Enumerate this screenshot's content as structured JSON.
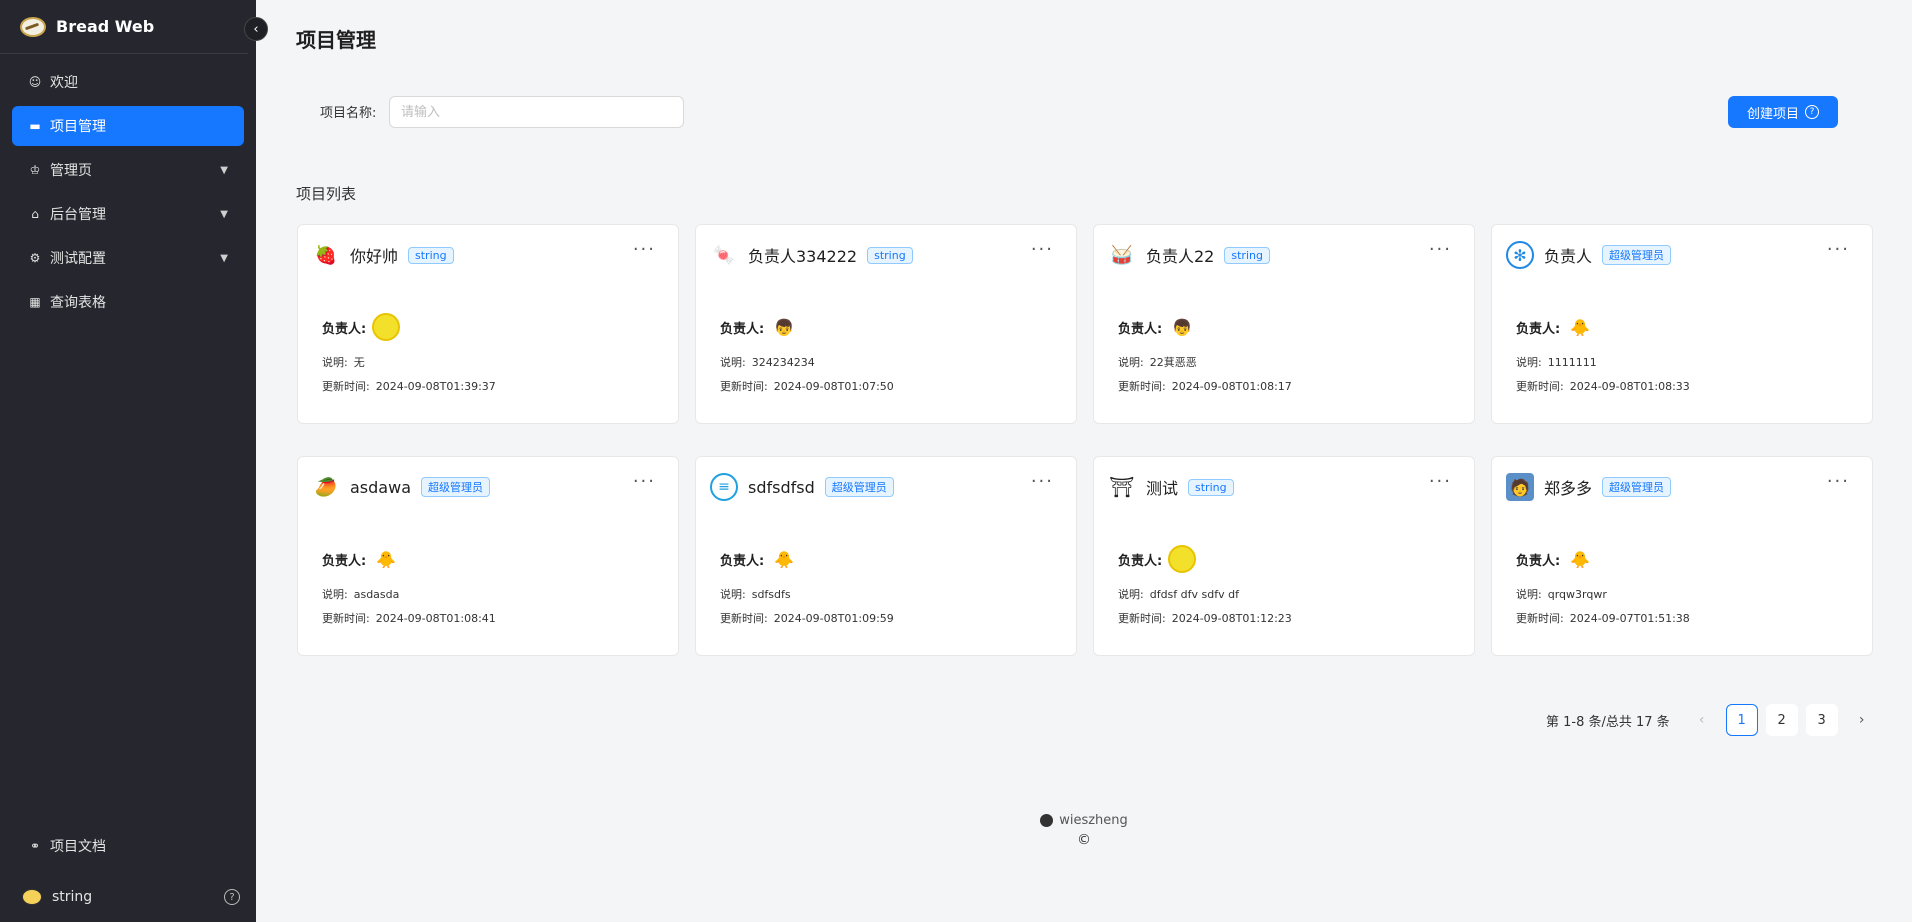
{
  "app": {
    "title": "Bread Web"
  },
  "sidebar": {
    "items": [
      {
        "label": "欢迎",
        "icon": "smile-icon"
      },
      {
        "label": "项目管理",
        "icon": "folder-icon",
        "active": true
      },
      {
        "label": "管理页",
        "icon": "crown-icon",
        "expandable": true
      },
      {
        "label": "后台管理",
        "icon": "lock-icon",
        "expandable": true
      },
      {
        "label": "测试配置",
        "icon": "gear-icon",
        "expandable": true
      },
      {
        "label": "查询表格",
        "icon": "table-icon"
      }
    ],
    "doc_link": "项目文档",
    "user_name": "string"
  },
  "header": {
    "title": "项目管理"
  },
  "filter": {
    "label": "项目名称:",
    "placeholder": "请输入",
    "value": ""
  },
  "create_button": {
    "label": "创建项目"
  },
  "list": {
    "title": "项目列表"
  },
  "field_labels": {
    "owner": "负责人:",
    "desc": "说明:",
    "updated": "更新时间:"
  },
  "cards": [
    {
      "name": "你好帅",
      "tag": "string",
      "desc": "无",
      "updated": "2024-09-08T01:39:37",
      "avatar": "strawberry",
      "owner": "yellow-ball"
    },
    {
      "name": "负责人334222",
      "tag": "string",
      "desc": "324234234",
      "updated": "2024-09-08T01:07:50",
      "avatar": "candy",
      "owner": "boy"
    },
    {
      "name": "负责人22",
      "tag": "string",
      "desc": "22萁恶恶",
      "updated": "2024-09-08T01:08:17",
      "avatar": "drum",
      "owner": "boy"
    },
    {
      "name": "负责人",
      "tag": "超级管理员",
      "desc": "1111111",
      "updated": "2024-09-08T01:08:33",
      "avatar": "blue-logo",
      "owner": "chick"
    },
    {
      "name": "asdawa",
      "tag": "超级管理员",
      "desc": "asdasda",
      "updated": "2024-09-08T01:08:41",
      "avatar": "mango",
      "owner": "chick"
    },
    {
      "name": "sdfsdfsd",
      "tag": "超级管理员",
      "desc": "sdfsdfs",
      "updated": "2024-09-08T01:09:59",
      "avatar": "chat-bubble",
      "owner": "chick"
    },
    {
      "name": "测试",
      "tag": "string",
      "desc": "dfdsf dfv sdfv df",
      "updated": "2024-09-08T01:12:23",
      "avatar": "gate",
      "owner": "yellow-ball"
    },
    {
      "name": "郑多多",
      "tag": "超级管理员",
      "desc": "qrqw3rqwr",
      "updated": "2024-09-07T01:51:38",
      "avatar": "person-photo",
      "owner": "chick"
    }
  ],
  "pagination": {
    "summary": "第 1-8 条/总共 17 条",
    "pages": [
      "1",
      "2",
      "3"
    ],
    "current": "1"
  },
  "footer": {
    "author": "wieszheng",
    "copyright": "©"
  },
  "colors": {
    "sidebar_bg": "#26272e",
    "accent": "#1677ff",
    "page_bg": "#f4f5f7"
  }
}
